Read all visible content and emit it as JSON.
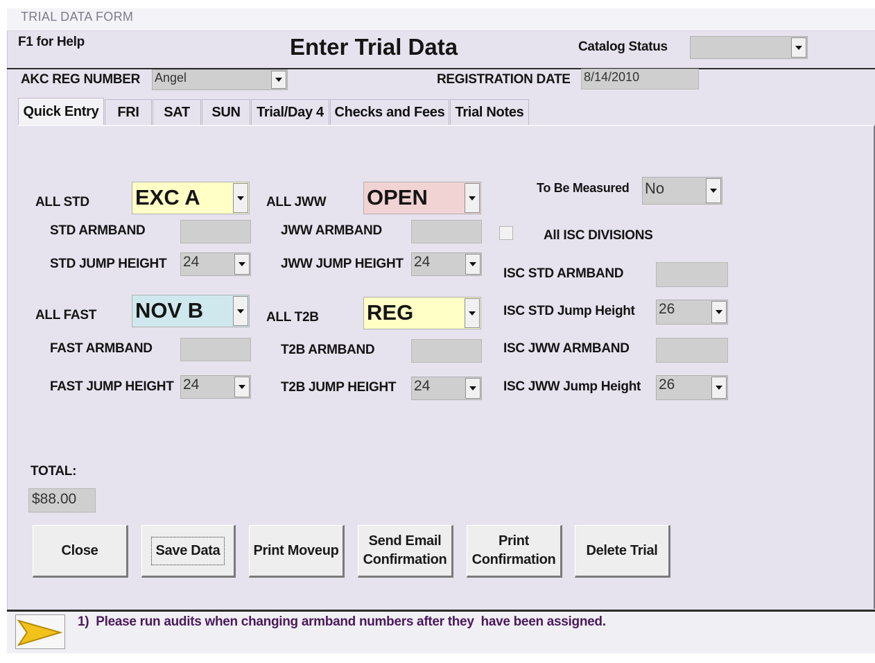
{
  "window": {
    "title": "TRIAL DATA FORM"
  },
  "header": {
    "help": "F1 for Help",
    "heading": "Enter Trial Data",
    "catalog_status_label": "Catalog Status",
    "catalog_status_value": "",
    "akc_reg_label": "AKC REG NUMBER",
    "akc_reg_value": "Angel",
    "reg_date_label": "REGISTRATION DATE",
    "reg_date_value": "8/14/2010"
  },
  "tabs": [
    {
      "label": "Quick Entry",
      "active": true
    },
    {
      "label": "FRI"
    },
    {
      "label": "SAT"
    },
    {
      "label": "SUN"
    },
    {
      "label": "Trial/Day 4"
    },
    {
      "label": "Checks and Fees"
    },
    {
      "label": "Trial Notes"
    }
  ],
  "std": {
    "label": "ALL STD",
    "value": "EXC A",
    "color": "#ffffc6",
    "armband_label": "STD ARMBAND",
    "armband_value": "",
    "jump_label": "STD JUMP HEIGHT",
    "jump_value": "24"
  },
  "jww": {
    "label": "ALL JWW",
    "value": "OPEN",
    "color": "#f2d3d3",
    "armband_label": "JWW ARMBAND",
    "armband_value": "",
    "jump_label": "JWW JUMP HEIGHT",
    "jump_value": "24"
  },
  "fast": {
    "label": "ALL FAST",
    "value": "NOV B",
    "color": "#cfe8ee",
    "armband_label": "FAST ARMBAND",
    "armband_value": "",
    "jump_label": "FAST JUMP HEIGHT",
    "jump_value": "24"
  },
  "t2b": {
    "label": "ALL T2B",
    "value": "REG",
    "color": "#ffffc6",
    "armband_label": "T2B ARMBAND",
    "armband_value": "",
    "jump_label": "T2B JUMP HEIGHT",
    "jump_value": "24"
  },
  "measure": {
    "label": "To Be Measured",
    "value": "No"
  },
  "isc": {
    "all_divisions_label": "All ISC DIVISIONS",
    "all_divisions_checked": false,
    "std_armband_label": "ISC STD ARMBAND",
    "std_armband_value": "",
    "std_jump_label": "ISC STD Jump Height",
    "std_jump_value": "26",
    "jww_armband_label": "ISC JWW ARMBAND",
    "jww_armband_value": "",
    "jww_jump_label": "ISC JWW Jump Height",
    "jww_jump_value": "26"
  },
  "total": {
    "label": "TOTAL:",
    "value": "$88.00"
  },
  "buttons": {
    "close": "Close",
    "save": "Save Data",
    "print_moveup": "Print Moveup",
    "send_email_1": "Send Email",
    "send_email_2": "Confirmation",
    "print_conf_1": "Print",
    "print_conf_2": "Confirmation",
    "delete": "Delete Trial"
  },
  "status": {
    "message": "1)  Please run audits when changing armband numbers after they  have been assigned.",
    "message_color": "#4a1a5a",
    "arrow_color": "#f2c21b"
  }
}
